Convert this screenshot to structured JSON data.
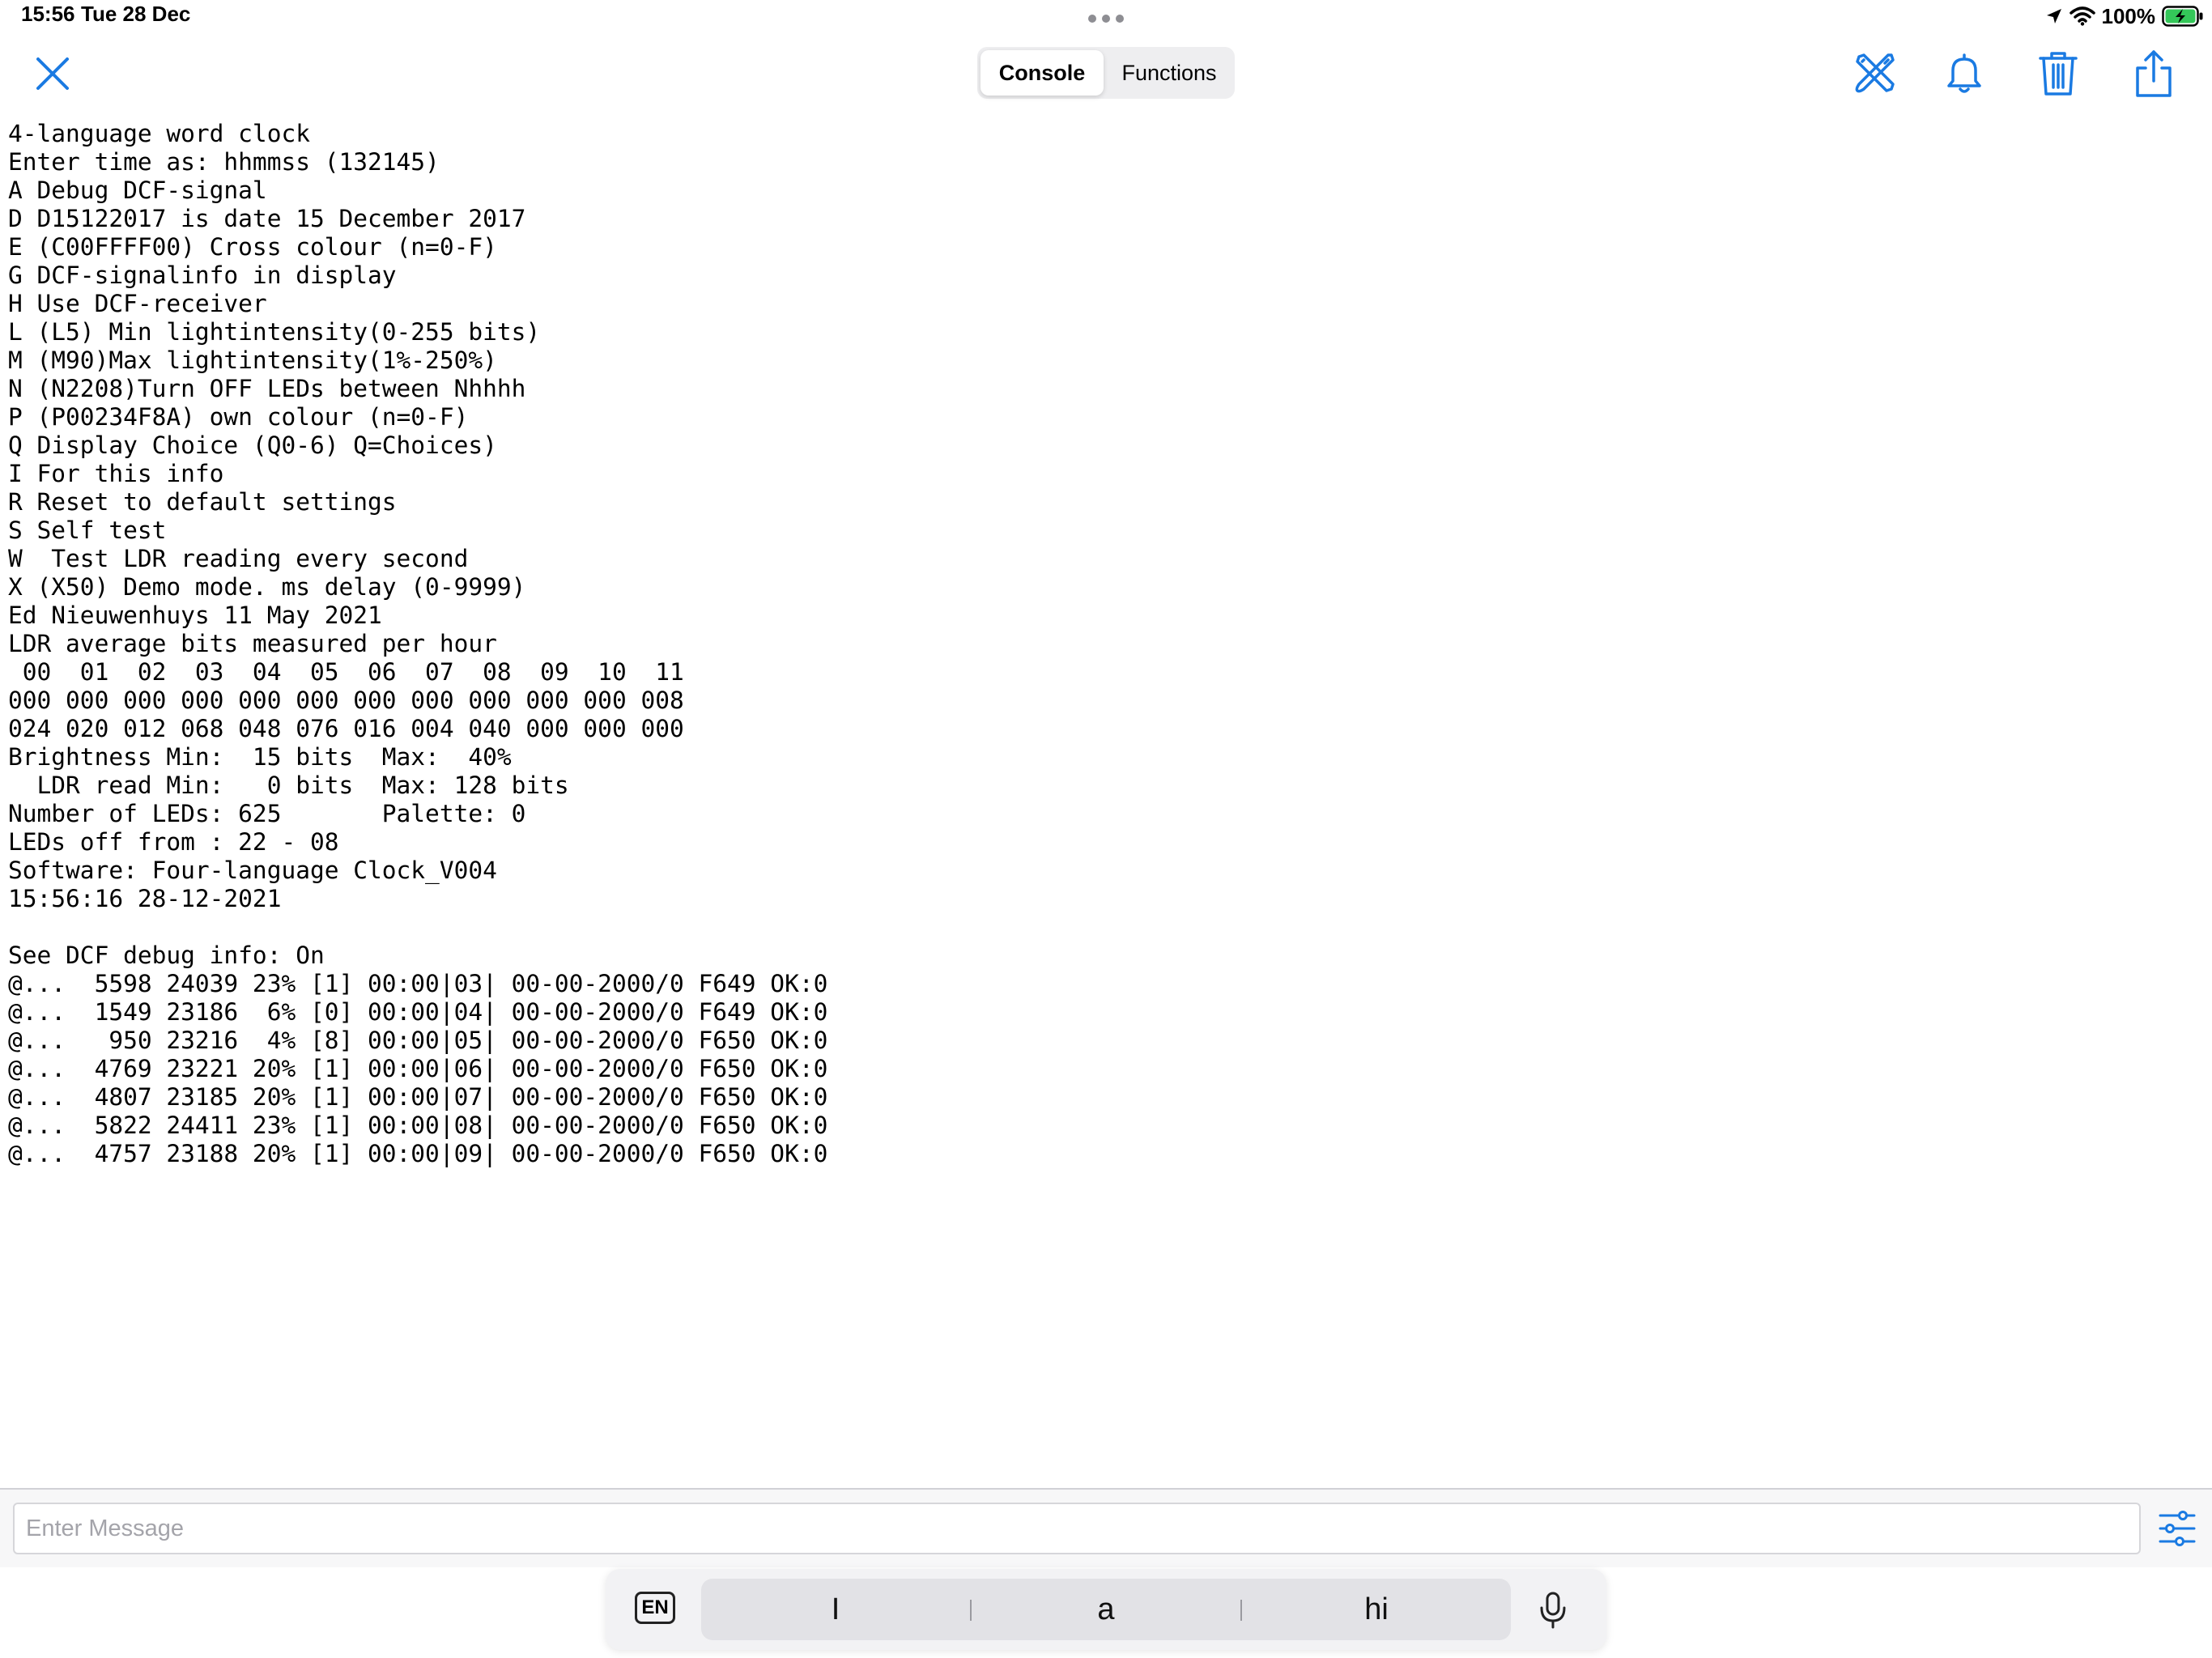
{
  "status_bar": {
    "time": "15:56",
    "date": "Tue 28 Dec",
    "battery_percent": "100%",
    "battery_level": 1.0,
    "battery_color": "#34c759"
  },
  "nav": {
    "tabs": [
      {
        "label": "Console",
        "selected": true
      },
      {
        "label": "Functions",
        "selected": false
      }
    ],
    "accent_color": "#1a7ae2",
    "icons": [
      "close-icon",
      "tools-icon",
      "bell-icon",
      "trash-icon",
      "share-icon"
    ]
  },
  "console": {
    "lines": [
      "4-language word clock",
      "Enter time as: hhmmss (132145)",
      "A Debug DCF-signal",
      "D D15122017 is date 15 December 2017",
      "E (C00FFFF00) Cross colour (n=0-F)",
      "G DCF-signalinfo in display",
      "H Use DCF-receiver",
      "L (L5) Min lightintensity(0-255 bits)",
      "M (M90)Max lightintensity(1%-250%)",
      "N (N2208)Turn OFF LEDs between Nhhhh",
      "P (P00234F8A) own colour (n=0-F)",
      "Q Display Choice (Q0-6) Q=Choices)",
      "I For this info",
      "R Reset to default settings",
      "S Self test",
      "W  Test LDR reading every second",
      "X (X50) Demo mode. ms delay (0-9999)",
      "Ed Nieuwenhuys 11 May 2021",
      "LDR average bits measured per hour",
      " 00  01  02  03  04  05  06  07  08  09  10  11",
      "000 000 000 000 000 000 000 000 000 000 000 008",
      "024 020 012 068 048 076 016 004 040 000 000 000",
      "Brightness Min:  15 bits  Max:  40%",
      "  LDR read Min:   0 bits  Max: 128 bits",
      "Number of LEDs: 625       Palette: 0",
      "LEDs off from : 22 - 08",
      "Software: Four-language Clock_V004",
      "15:56:16 28-12-2021",
      "",
      "See DCF debug info: On",
      "@...  5598 24039 23% [1] 00:00|03| 00-00-2000/0 F649 OK:0",
      "@...  1549 23186  6% [0] 00:00|04| 00-00-2000/0 F649 OK:0",
      "@...   950 23216  4% [8] 00:00|05| 00-00-2000/0 F650 OK:0",
      "@...  4769 23221 20% [1] 00:00|06| 00-00-2000/0 F650 OK:0",
      "@...  4807 23185 20% [1] 00:00|07| 00-00-2000/0 F650 OK:0",
      "@...  5822 24411 23% [1] 00:00|08| 00-00-2000/0 F650 OK:0",
      "@...  4757 23188 20% [1] 00:00|09| 00-00-2000/0 F650 OK:0"
    ]
  },
  "input": {
    "placeholder": "Enter Message",
    "value": ""
  },
  "keyboard_bar": {
    "language": "EN",
    "suggestions": [
      "I",
      "a",
      "hi"
    ]
  }
}
